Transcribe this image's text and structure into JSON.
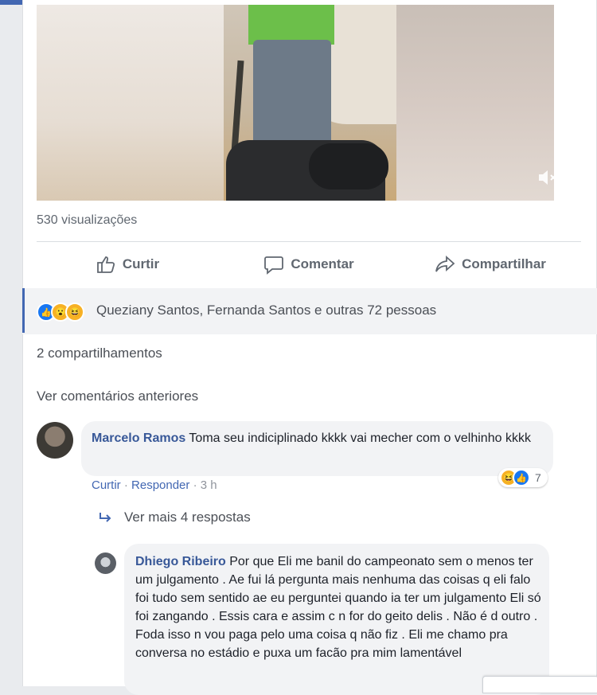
{
  "video": {
    "mute_icon": "mute-icon"
  },
  "views": "530 visualizações",
  "actions": {
    "like": "Curtir",
    "comment": "Comentar",
    "share": "Compartilhar"
  },
  "reactions": {
    "text": "Queziany Santos, Fernanda Santos e outras 72 pessoas",
    "icons": [
      "like",
      "wow",
      "haha"
    ]
  },
  "shares": "2 compartilhamentos",
  "previous_comments": "Ver comentários anteriores",
  "comment1": {
    "author": "Marcelo Ramos",
    "text": "Toma seu indiciplinado kkkk vai mecher com o velhinho kkkk",
    "like": "Curtir",
    "reply": "Responder",
    "time": "3 h",
    "reaction_count": "7"
  },
  "more_replies": "Ver mais 4 respostas",
  "comment2": {
    "author": "Dhiego Ribeiro",
    "text": "Por que Eli me banil do campeonato sem o menos ter um julgamento . Ae fui lá pergunta mais nenhuma das coisas q eli falo foi tudo sem sentido ae eu perguntei quando ia ter um julgamento Eli só foi zangando . Essis cara e assim c n for do geito delis . Não é d outro . Foda isso n vou paga pelo uma coisa q não fiz . Eli me chamo pra conversa no estádio e puxa um facão pra mim lamentável"
  },
  "colors": {
    "link": "#385898",
    "accent": "#4267b2",
    "muted": "#606770"
  }
}
